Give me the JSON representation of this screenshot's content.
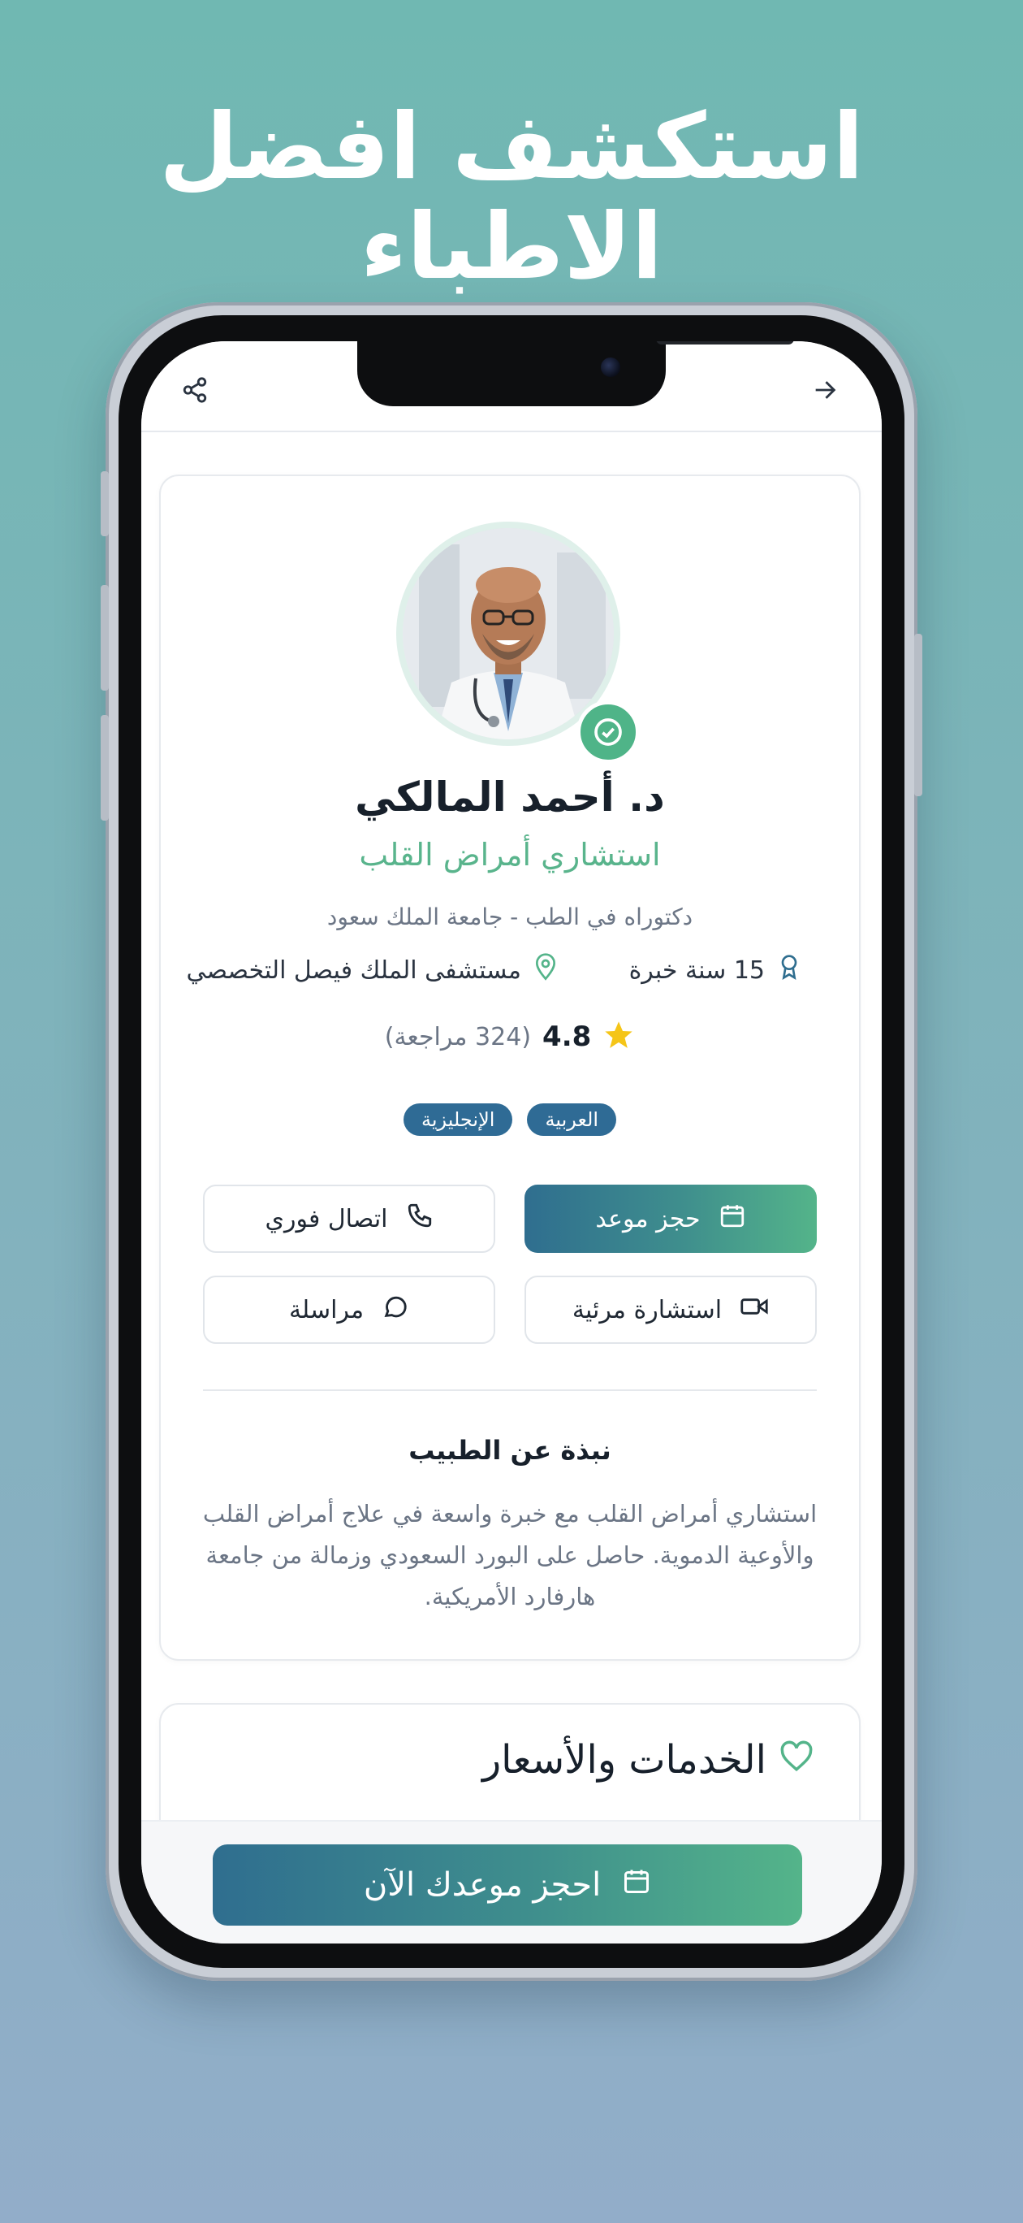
{
  "headline": "استكشف افضل الاطباء",
  "topbar": {
    "back_icon": "arrow-right-icon",
    "share_icon": "share-icon"
  },
  "profile": {
    "name": "د. أحمد المالكي",
    "specialty": "استشاري أمراض القلب",
    "degree": "دكتوراه في الطب - جامعة الملك سعود",
    "experience": "15 سنة خبرة",
    "hospital": "مستشفى الملك فيصل التخصصي",
    "rating": "4.8",
    "reviews": "(324 مراجعة)",
    "languages": [
      "العربية",
      "الإنجليزية"
    ]
  },
  "actions": {
    "book": "حجز موعد",
    "call": "اتصال فوري",
    "video": "استشارة مرئية",
    "message": "مراسلة"
  },
  "about": {
    "title": "نبذة عن الطبيب",
    "text": "استشاري أمراض القلب مع خبرة واسعة في علاج أمراض القلب والأوعية الدموية. حاصل على البورد السعودي وزمالة من جامعة هارفارد الأمريكية."
  },
  "services": {
    "title": "الخدمات والأسعار"
  },
  "cta": {
    "label": "احجز موعدك الآن"
  },
  "colors": {
    "accent_green": "#54b48a",
    "accent_blue": "#2f6e8f",
    "verified": "#4fb488",
    "star": "#f5c518"
  }
}
